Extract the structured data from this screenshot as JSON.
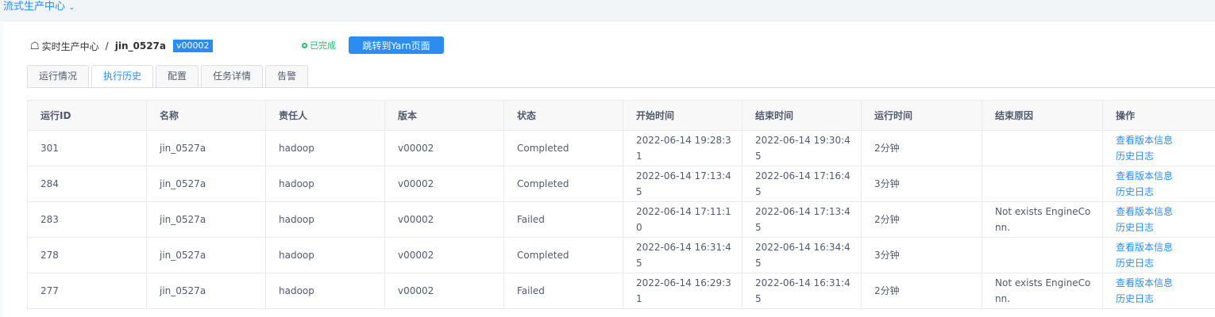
{
  "topbar": {
    "title": "流式生产中心",
    "chevron_icon": "chevron-down-icon"
  },
  "breadcrumb": {
    "home_icon": "home-icon",
    "root": "实时生产中心",
    "separator": "/",
    "job_name": "jin_0527a",
    "version": "v00002"
  },
  "status": {
    "text": "已完成",
    "color": "#19be6b"
  },
  "yarn_button": "跳转到Yarn页面",
  "tabs": [
    {
      "label": "运行情况",
      "active": false
    },
    {
      "label": "执行历史",
      "active": true
    },
    {
      "label": "配置",
      "active": false
    },
    {
      "label": "任务详情",
      "active": false
    },
    {
      "label": "告警",
      "active": false
    }
  ],
  "table": {
    "headers": [
      "运行ID",
      "名称",
      "责任人",
      "版本",
      "状态",
      "开始时间",
      "结束时间",
      "运行时间",
      "结束原因",
      "操作"
    ],
    "action_labels": {
      "version_info": "查看版本信息",
      "history_log": "历史日志"
    },
    "rows": [
      {
        "id": "301",
        "name": "jin_0527a",
        "owner": "hadoop",
        "version": "v00002",
        "status": "Completed",
        "start": "2022-06-14 19:28:31",
        "end": "2022-06-14 19:30:45",
        "duration": "2分钟",
        "reason": ""
      },
      {
        "id": "284",
        "name": "jin_0527a",
        "owner": "hadoop",
        "version": "v00002",
        "status": "Completed",
        "start": "2022-06-14 17:13:45",
        "end": "2022-06-14 17:16:45",
        "duration": "3分钟",
        "reason": ""
      },
      {
        "id": "283",
        "name": "jin_0527a",
        "owner": "hadoop",
        "version": "v00002",
        "status": "Failed",
        "start": "2022-06-14 17:11:10",
        "end": "2022-06-14 17:13:45",
        "duration": "2分钟",
        "reason": "Not exists EngineConn."
      },
      {
        "id": "278",
        "name": "jin_0527a",
        "owner": "hadoop",
        "version": "v00002",
        "status": "Completed",
        "start": "2022-06-14 16:31:45",
        "end": "2022-06-14 16:34:45",
        "duration": "3分钟",
        "reason": ""
      },
      {
        "id": "277",
        "name": "jin_0527a",
        "owner": "hadoop",
        "version": "v00002",
        "status": "Failed",
        "start": "2022-06-14 16:29:31",
        "end": "2022-06-14 16:31:45",
        "duration": "2分钟",
        "reason": "Not exists EngineConn."
      }
    ]
  },
  "colors": {
    "accent": "#2d8cf0",
    "success": "#19be6b",
    "text": "#515a6e"
  }
}
